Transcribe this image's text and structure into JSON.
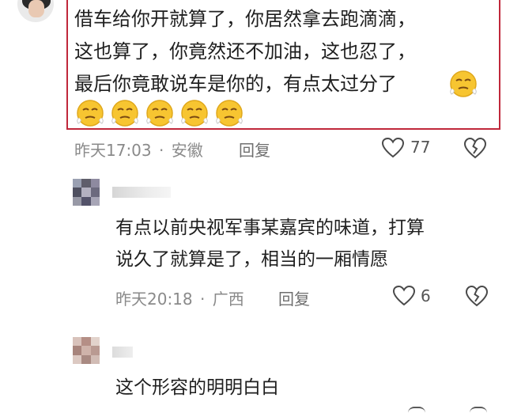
{
  "comments": [
    {
      "lines": [
        "借车给你开就算了，你居然拿去跑滴滴，",
        "这也算了，你竟然还不加油，这也忍了，",
        "最后你竟敢说车是你的，有点太过分了"
      ],
      "emoji_name": "face-with-steam-emoji",
      "emoji_count_inline": 1,
      "emoji_count_row": 5,
      "time": "昨天17:03",
      "location": "安徽",
      "reply_label": "回复",
      "likes": "77"
    },
    {
      "lines": [
        "有点以前央视军事某嘉宾的味道，打算",
        "说久了就算是了，相当的一厢情愿"
      ],
      "time": "昨天20:18",
      "location": "广西",
      "reply_label": "回复",
      "likes": "6"
    },
    {
      "lines": [
        "这个形容的明明白白"
      ]
    }
  ],
  "separator": "·",
  "icons": {
    "like": "heart-outline-icon",
    "dislike": "broken-heart-icon"
  },
  "colors": {
    "highlight_border": "#c0283b",
    "emoji_yellow": "#f7c531",
    "meta_gray": "#8a8a8a"
  }
}
